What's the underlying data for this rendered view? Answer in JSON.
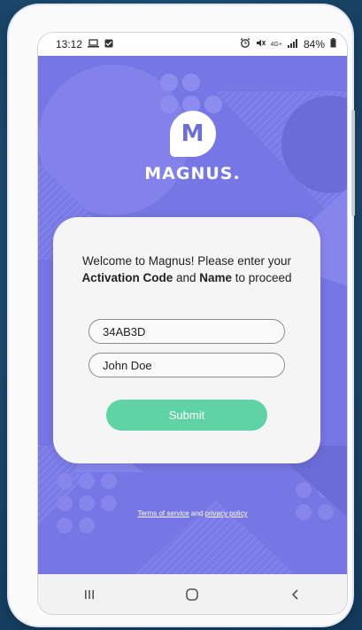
{
  "status_bar": {
    "time": "13:12",
    "battery": "84%",
    "icons": [
      "laptop-icon",
      "message-icon",
      "alarm-icon",
      "mute-icon",
      "4g-icon",
      "signal-icon",
      "battery-icon"
    ]
  },
  "app": {
    "logo_letter": "M",
    "brand_name": "MAGNUS.",
    "colors": {
      "background": "#7b7be8",
      "accent": "#5fd3a6",
      "card": "#f5f5f6"
    }
  },
  "card": {
    "welcome_prefix": "Welcome to Magnus! Please enter your ",
    "activation_code_label": "Activation Code",
    "and_text": " and ",
    "name_label": "Name",
    "welcome_suffix": " to proceed",
    "activation_code_value": "34AB3D",
    "name_value": "John Doe",
    "submit_label": "Submit"
  },
  "footer": {
    "terms_link": "Terms of service",
    "and_text": " and ",
    "privacy_link": "privacy policy"
  },
  "nav_bar": {
    "items": [
      "recent-apps-icon",
      "home-icon",
      "back-icon"
    ]
  }
}
